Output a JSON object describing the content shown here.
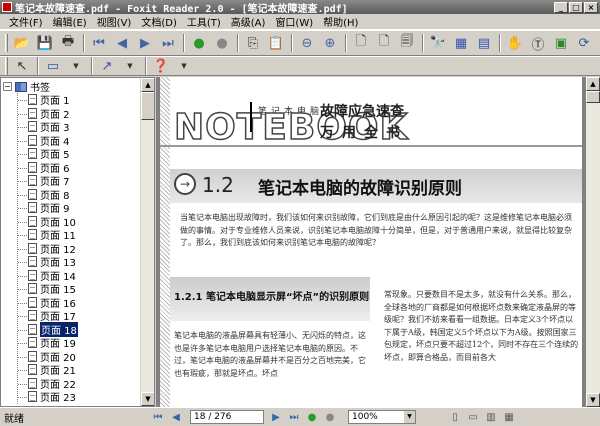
{
  "window": {
    "title": "笔记本故障速查.pdf - Foxit Reader 2.0 - [笔记本故障速查.pdf]",
    "buttons": [
      "minimize",
      "maximize",
      "close"
    ]
  },
  "menu": [
    "文件(F)",
    "编辑(E)",
    "视图(V)",
    "文档(D)",
    "工具(T)",
    "高级(A)",
    "窗口(W)",
    "帮助(H)"
  ],
  "toolbar1_icons": [
    "open-icon",
    "save-icon",
    "print-icon",
    "first-page-icon",
    "prev-page-icon",
    "next-page-icon",
    "last-page-icon",
    "go-back-icon",
    "go-forward-icon",
    "copy-icon",
    "paste-icon",
    "zoom-out-icon",
    "zoom-in-icon",
    "single-page-icon",
    "facing-icon",
    "continuous-icon",
    "find-icon",
    "properties-icon",
    "layout-icon",
    "hand-tool-icon",
    "text-select-icon",
    "snapshot-icon",
    "rotate-icon"
  ],
  "toolbar2_icons": [
    "select-arrow-icon",
    "form-icon",
    "annotation-icon",
    "help-icon"
  ],
  "bookmarks": {
    "root": "书签",
    "items": [
      "页面 1",
      "页面 2",
      "页面 3",
      "页面 4",
      "页面 5",
      "页面 6",
      "页面 7",
      "页面 8",
      "页面 9",
      "页面 10",
      "页面 11",
      "页面 12",
      "页面 13",
      "页面 14",
      "页面 15",
      "页面 16",
      "页面 17",
      "页面 18",
      "页面 19",
      "页面 20",
      "页面 21",
      "页面 22",
      "页面 23"
    ],
    "selected_index": 17
  },
  "document": {
    "series_top": "笔记本电脑",
    "brand": "NOTEBOOK",
    "series_title1": "故障应急速查",
    "series_title2": "万用全书",
    "chapter_num": "1.2",
    "chapter_title": "笔记本电脑的故障识别原则",
    "intro": "当笔记本电脑出现故障时，我们该如何来识别故障，它们到底是由什么原因引起的呢？这是维修笔记本电脑必须做的事情。对于专业维修人员来说，识别笔记本电脑故障十分简单，但是，对于普通用户来说，就显得比较复杂了。那么，我们到底该如何来识别笔记本电脑的故障呢？",
    "section_title": "1.2.1 笔记本电脑显示屏“坏点”的识别原则",
    "left_col": "笔记本电脑的液晶屏幕具有轻薄小、无闪烁的特点，这也是许多笔记本电脑用户选择笔记本电脑的原因。不过，笔记本电脑的液晶屏幕并不是百分之百地完美，它也有瑕疵，那就是坏点。坏点",
    "right_col": "常现象。只要数目不是太多，就没有什么关系。那么，全球各地的厂商都是如何根据坏点数来确定液晶屏的等级呢？我们不妨来看看一组数据。日本定义3个坏点以下属于A级，韩国定义5个坏点以下为A级。按照国家三包规定，坏点只要不超过12个，同时不存在三个连续的坏点，即算合格品，而目前各大"
  },
  "status": {
    "text": "就绪",
    "page_indicator": "18 / 276",
    "zoom": "100%"
  }
}
